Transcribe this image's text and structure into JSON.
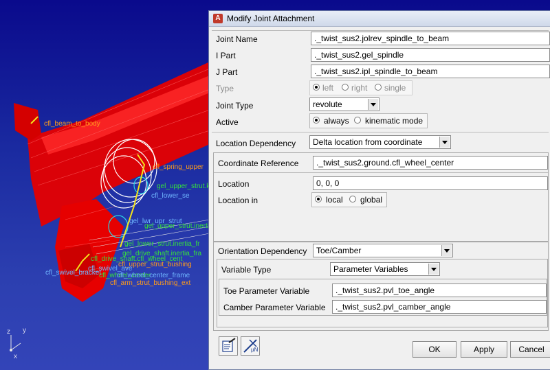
{
  "viewport": {
    "labels_orange": [
      "cfl_beam_to_body",
      "cfl_spring_upper",
      "cfl_upper_strut_bushing",
      "cfl_arm_strut_bushing_ext"
    ],
    "labels_green": [
      "gel_upper_strut.k",
      "gel_lower_strut.inertia_fr",
      "gel_drive_shaft.inertia_fra",
      "gel_upper_strut.inertia",
      "cfl_drive_shaft.cfl_wheel_cent",
      "cfl_wheel_center"
    ],
    "labels_blue": [
      "gel_lwr_upr_strut",
      "cfl_lower_se",
      "cfl_swivel_ave",
      "cfl_wheel_center_frame",
      "cfl_swivel_bracket"
    ],
    "axis": {
      "z": "z",
      "y": "y",
      "x": "x"
    }
  },
  "dialog": {
    "title": "Modify Joint Attachment",
    "title_icon": "A",
    "joint_name": {
      "label": "Joint Name",
      "value": "._twist_sus2.jolrev_spindle_to_beam"
    },
    "i_part": {
      "label": "I Part",
      "value": "._twist_sus2.gel_spindle"
    },
    "j_part": {
      "label": "J Part",
      "value": "._twist_sus2.ipl_spindle_to_beam"
    },
    "type": {
      "label": "Type",
      "options": [
        "left",
        "right",
        "single"
      ],
      "selected": "left"
    },
    "joint_type": {
      "label": "Joint Type",
      "value": "revolute"
    },
    "active": {
      "label": "Active",
      "options": [
        "always",
        "kinematic mode"
      ],
      "selected": "always"
    },
    "location_dependency": {
      "label": "Location Dependency",
      "value": "Delta location from coordinate"
    },
    "coordinate_reference": {
      "label": "Coordinate Reference",
      "value": "._twist_sus2.ground.cfl_wheel_center"
    },
    "location": {
      "label": "Location",
      "value": "0, 0, 0"
    },
    "location_in": {
      "label": "Location in",
      "options": [
        "local",
        "global"
      ],
      "selected": "local"
    },
    "orientation_dependency": {
      "label": "Orientation Dependency",
      "value": "Toe/Camber"
    },
    "variable_type": {
      "label": "Variable Type",
      "value": "Parameter Variables"
    },
    "toe_param": {
      "label": "Toe Parameter Variable",
      "value": "._twist_sus2.pvl_toe_angle"
    },
    "camber_param": {
      "label": "Camber Parameter Variable",
      "value": "._twist_sus2.pvl_camber_angle"
    },
    "buttons": {
      "ok": "OK",
      "apply": "Apply",
      "cancel": "Cancel"
    },
    "icon_buttons": [
      "edit-comments-icon",
      "function-builder-icon"
    ],
    "icon_text": {
      "mu_n": "μN"
    }
  }
}
